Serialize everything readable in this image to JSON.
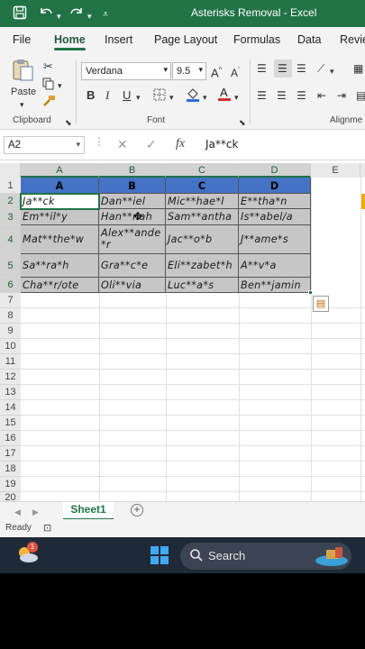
{
  "window": {
    "title": "Asterisks Removal  -  Excel"
  },
  "ribbon_tabs": [
    "File",
    "Home",
    "Insert",
    "Page Layout",
    "Formulas",
    "Data",
    "Revie"
  ],
  "active_tab": "Home",
  "ribbon": {
    "clipboard": {
      "paste_label": "Paste",
      "group_label": "Clipboard"
    },
    "font": {
      "family": "Verdana",
      "size": "9.5",
      "group_label": "Font",
      "bold": "B",
      "italic": "I",
      "underline": "U"
    },
    "alignment": {
      "group_label": "Alignme"
    }
  },
  "formula_bar": {
    "name_box": "A2",
    "fx_label": "fx",
    "formula": "Ja**ck"
  },
  "columns": [
    "A",
    "B",
    "C",
    "D",
    "E"
  ],
  "rows": [
    "1",
    "2",
    "3",
    "4",
    "5",
    "6",
    "7",
    "8",
    "9",
    "10",
    "11",
    "12",
    "13",
    "14",
    "15",
    "16",
    "17",
    "18",
    "19",
    "20"
  ],
  "table": {
    "headers": [
      "A",
      "B",
      "C",
      "D"
    ],
    "cells": [
      [
        "Ja**ck",
        "Dan**iel",
        "Mic**hae*l",
        "E**tha*n"
      ],
      [
        "Em**il*y",
        "Han**nah",
        "Sam**antha",
        "Is**abel/a"
      ],
      [
        "Mat**the*w",
        "Alex**ande*r",
        "Jac**o*b",
        "J**ame*s"
      ],
      [
        "Sa**ra*h",
        "Gra**c*e",
        "Eli**zabet*h",
        "A**v*a"
      ],
      [
        "Cha**r/ote",
        "Oli**via",
        "Luc**a*s",
        "Ben**jamin"
      ]
    ]
  },
  "sheet_tabs": [
    "Sheet1"
  ],
  "status": {
    "ready": "Ready"
  },
  "taskbar": {
    "search_label": "Search",
    "weather_badge": "1"
  },
  "colors": {
    "excel_green": "#217346",
    "header_blue": "#4472c4",
    "data_gray": "#c6c6c6"
  }
}
